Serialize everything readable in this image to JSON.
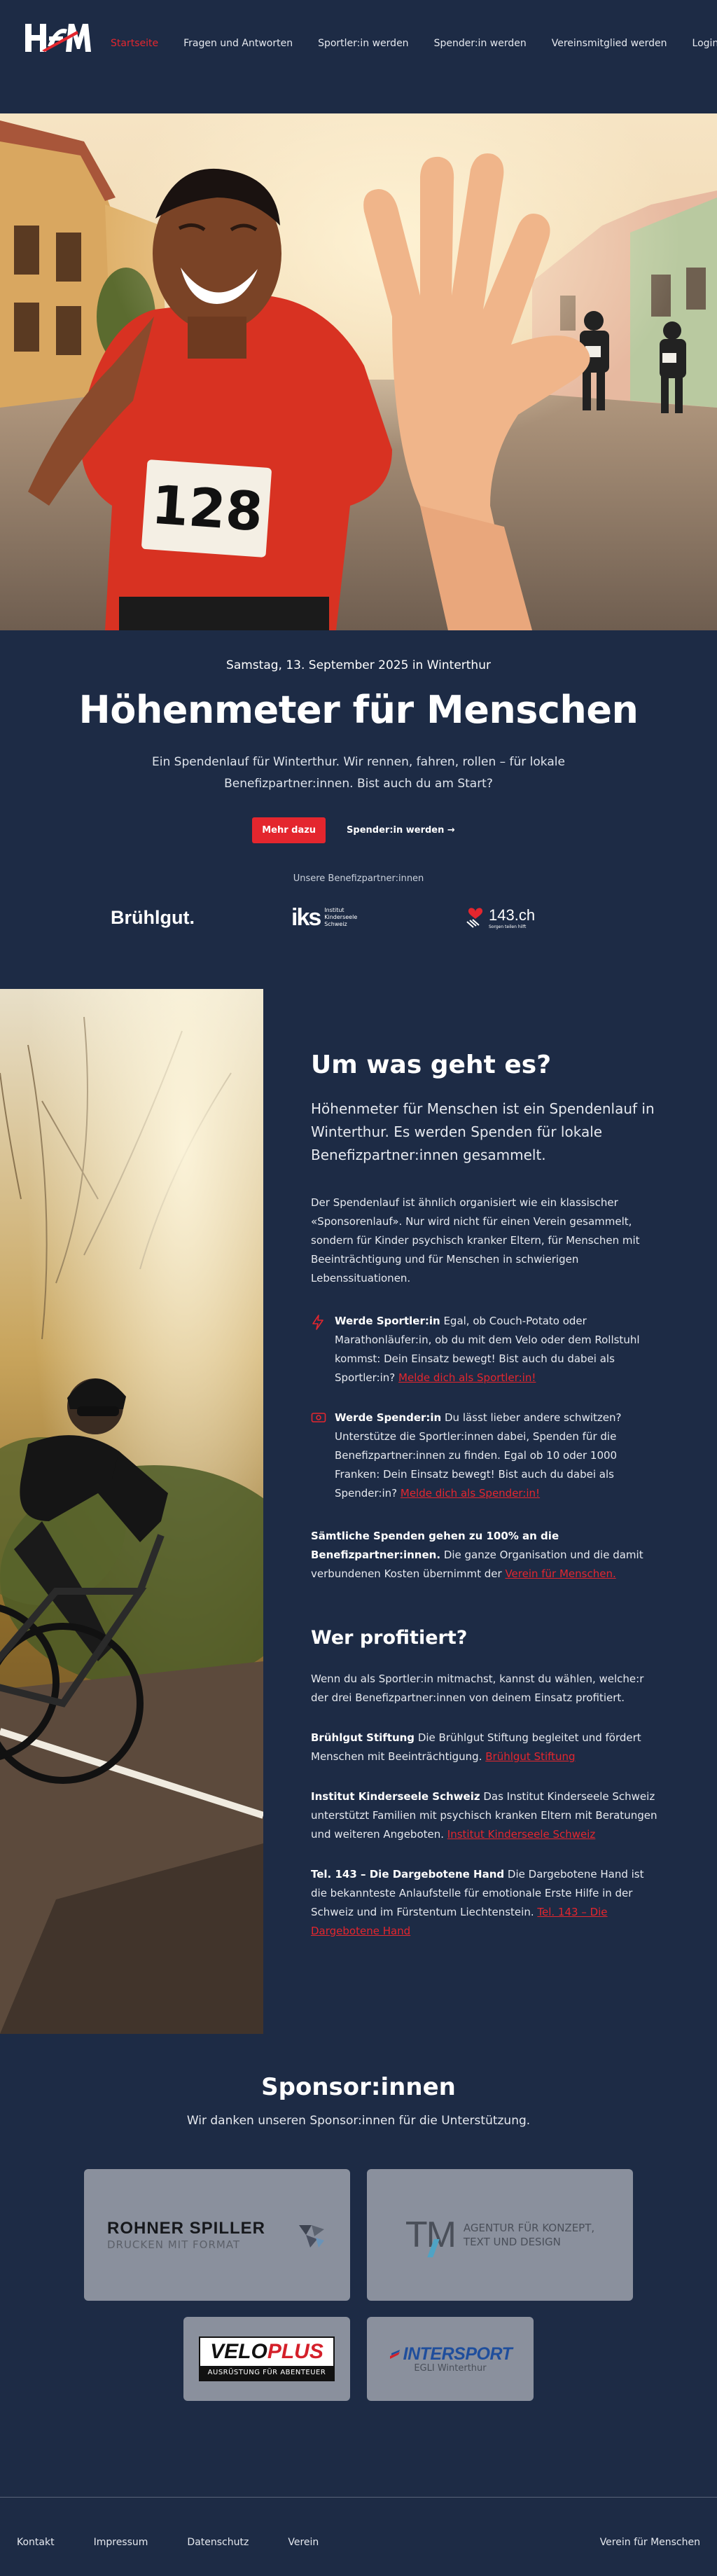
{
  "nav": {
    "logo_text": "HfM",
    "items": [
      {
        "label": "Startseite",
        "active": true
      },
      {
        "label": "Fragen und Antworten"
      },
      {
        "label": "Sportler:in werden"
      },
      {
        "label": "Spender:in werden"
      },
      {
        "label": "Vereinsmitglied werden"
      },
      {
        "label": "Login"
      }
    ]
  },
  "hero": {
    "bib_number": "128",
    "date": "Samstag, 13. September 2025 in Winterthur",
    "title": "Höhenmeter für Menschen",
    "lead": "Ein Spendenlauf für Winterthur. Wir rennen, fahren, rollen – für lokale Benefizpartner:innen. Bist auch du am Start?",
    "cta_primary": "Mehr dazu",
    "cta_secondary": "Spender:in werden →",
    "partners_label": "Unsere Benefizpartner:innen",
    "partners": [
      {
        "name": "Brühlgut."
      },
      {
        "mark": "iks",
        "name_lines": [
          "Institut",
          "Kinderseele",
          "Schweiz"
        ]
      },
      {
        "name": "143.ch",
        "tagline": "Sorgen teilen hilft"
      }
    ]
  },
  "about": {
    "title": "Um was geht es?",
    "lead": "Höhenmeter für Menschen ist ein Spendenlauf in Winterthur. Es werden Spenden für lokale Benefizpartner:innen gesammelt.",
    "intro": "Der Spendenlauf ist ähnlich organisiert wie ein klassischer «Sponsorenlauf». Nur wird nicht für einen Verein gesammelt, sondern für Kinder psychisch kranker Eltern, für Menschen mit Beeinträchtigung und für Menschen in schwierigen Lebenssituationen.",
    "feature_athlete": {
      "icon": "lightning-icon",
      "title": "Werde Sportler:in",
      "text": " Egal, ob Couch-Potato oder Marathonläufer:in, ob du mit dem Velo oder dem Rollstuhl kommst: Dein Einsatz bewegt! Bist auch du dabei als Sportler:in? ",
      "link": "Melde dich als Sportler:in!"
    },
    "feature_donor": {
      "icon": "money-icon",
      "title": "Werde Spender:in",
      "text": " Du lässt lieber andere schwitzen? Unterstütze die Sportler:innen dabei, Spenden für die Benefizpartner:innen zu finden. Egal ob 10 oder 1000 Franken: Dein Einsatz bewegt! Bist auch du dabei als Spender:in? ",
      "link": "Melde dich als Spender:in!"
    },
    "donations_bold": "Sämtliche Spenden gehen zu 100% an die Benefizpartner:innen.",
    "donations_text": " Die ganze Organisation und die damit verbundenen Kosten übernimmt der ",
    "donations_link": "Verein für Menschen."
  },
  "benefit": {
    "title": "Wer profitiert?",
    "intro": "Wenn du als Sportler:in mitmachst, kannst du wählen, welche:r der drei Benefizpartner:innen von deinem Einsatz profitiert.",
    "items": [
      {
        "name": "Brühlgut Stiftung",
        "text": " Die Brühlgut Stiftung begleitet und fördert Menschen mit Beeinträchtigung. ",
        "link": "Brühlgut Stiftung"
      },
      {
        "name": "Institut Kinderseele Schweiz",
        "text": " Das Institut Kinderseele Schweiz unterstützt Familien mit psychisch kranken Eltern mit Beratungen und weiteren Angeboten. ",
        "link": "Institut Kinderseele Schweiz"
      },
      {
        "name": "Tel. 143 – Die Dargebotene Hand",
        "text": " Die Dargebotene Hand ist die bekannteste Anlaufstelle für emotionale Erste Hilfe in der Schweiz und im Fürstentum Liechtenstein. ",
        "link": "Tel. 143 – Die Dargebotene Hand"
      }
    ]
  },
  "sponsors": {
    "title": "Sponsor:innen",
    "subtitle": "Wir danken unseren Sponsor:innen für die Unterstützung.",
    "items": [
      {
        "name": "ROHNER SPILLER",
        "tagline": "DRUCKEN MIT FORMAT"
      },
      {
        "name": "TM",
        "tagline_lines": [
          "AGENTUR FÜR KONZEPT,",
          "TEXT UND DESIGN"
        ]
      },
      {
        "name_a": "VELO",
        "name_b": "PLUS",
        "tagline": "AUSRÜSTUNG FÜR ABENTEUER"
      },
      {
        "name": "INTERSPORT",
        "tagline": "EGLI Winterthur"
      }
    ]
  },
  "footer": {
    "links": [
      "Kontakt",
      "Impressum",
      "Datenschutz",
      "Verein"
    ],
    "right": "Verein für Menschen"
  },
  "colors": {
    "background": "#1d2b45",
    "accent": "#e4262e",
    "card": "#8a909d"
  }
}
